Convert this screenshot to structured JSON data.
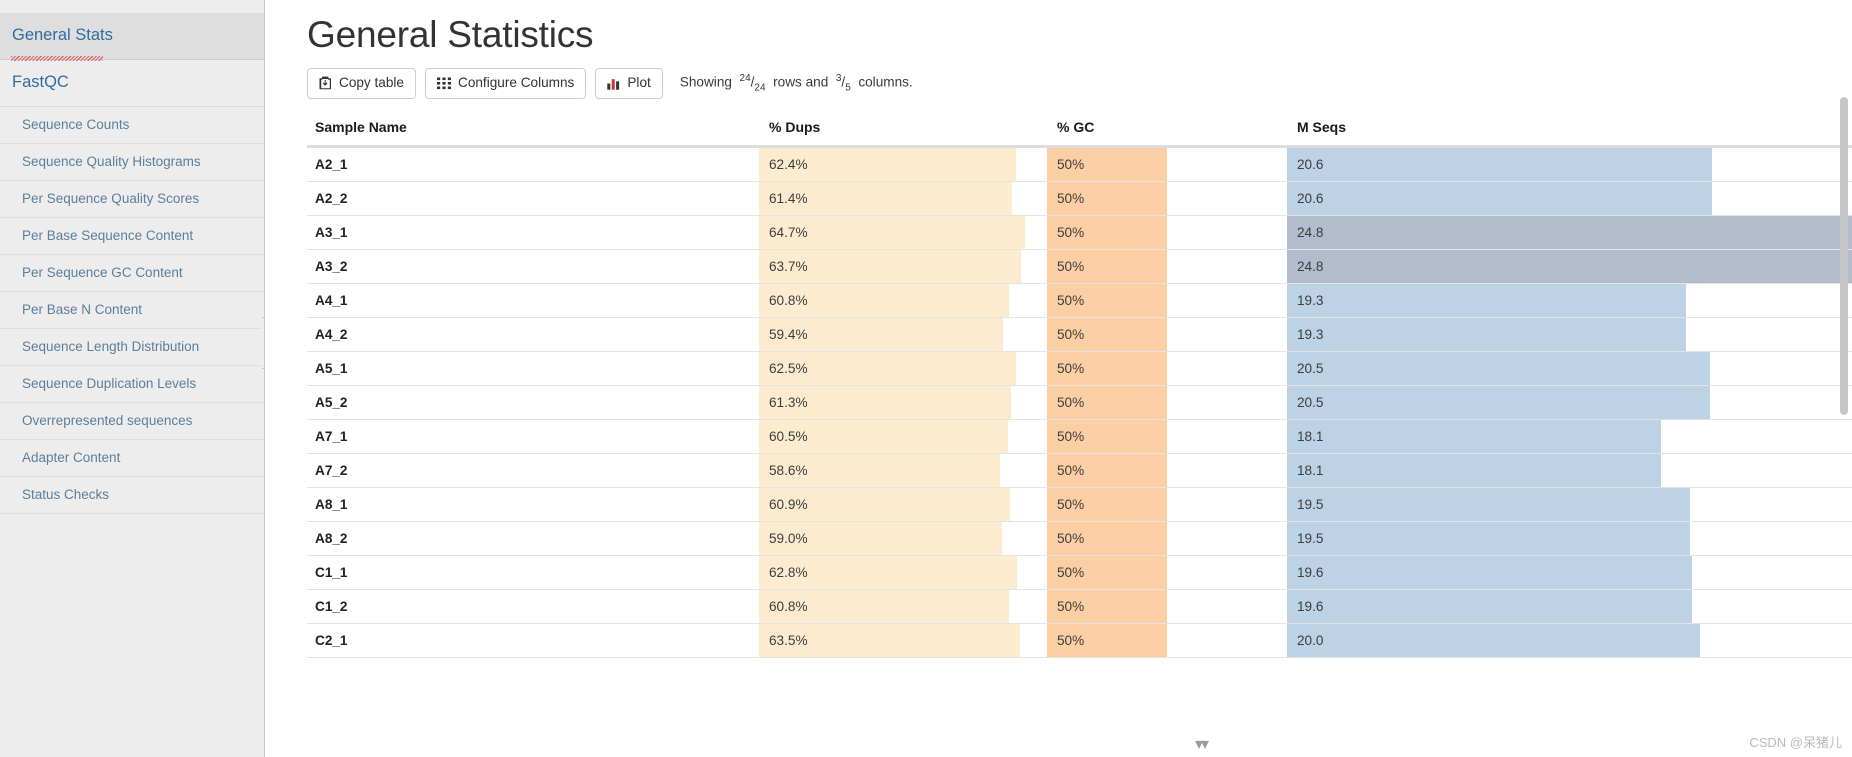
{
  "sidebar": {
    "general_stats_label": "General Stats",
    "module_label": "FastQC",
    "items": [
      {
        "label": "Sequence Counts"
      },
      {
        "label": "Sequence Quality Histograms"
      },
      {
        "label": "Per Sequence Quality Scores"
      },
      {
        "label": "Per Base Sequence Content"
      },
      {
        "label": "Per Sequence GC Content"
      },
      {
        "label": "Per Base N Content"
      },
      {
        "label": "Sequence Length Distribution"
      },
      {
        "label": "Sequence Duplication Levels"
      },
      {
        "label": "Overrepresented sequences"
      },
      {
        "label": "Adapter Content"
      },
      {
        "label": "Status Checks"
      }
    ]
  },
  "main": {
    "title": "General Statistics",
    "toolbar": {
      "copy_table_label": "Copy table",
      "configure_columns_label": "Configure Columns",
      "plot_label": "Plot",
      "showing_prefix": "Showing",
      "rows_shown": "24",
      "rows_total": "24",
      "rows_word": "rows and",
      "cols_shown": "3",
      "cols_total": "5",
      "cols_word": "columns."
    },
    "columns": [
      {
        "key": "sample",
        "label": "Sample Name"
      },
      {
        "key": "dups",
        "label": "% Dups"
      },
      {
        "key": "gc",
        "label": "% GC"
      },
      {
        "key": "seqs",
        "label": "M Seqs"
      }
    ],
    "colors": {
      "dups_bar": "#fdebd0",
      "gc_bar": "#fbcfa3",
      "seqs_bar": "#bdd2e5",
      "seqs_bar_highlight": "#b3bccd",
      "row_highlight": "#b3bccd",
      "link": "#2f6ca3",
      "sidebar_bg": "#ededed"
    },
    "rows": [
      {
        "sample": "A2_1",
        "dups": "62.4%",
        "dups_pct": 62.4,
        "gc": "50%",
        "gc_pct": 50,
        "seqs": "20.6",
        "seqs_pct": 20.6,
        "highlight": false
      },
      {
        "sample": "A2_2",
        "dups": "61.4%",
        "dups_pct": 61.4,
        "gc": "50%",
        "gc_pct": 50,
        "seqs": "20.6",
        "seqs_pct": 20.6,
        "highlight": false
      },
      {
        "sample": "A3_1",
        "dups": "64.7%",
        "dups_pct": 64.7,
        "gc": "50%",
        "gc_pct": 50,
        "seqs": "24.8",
        "seqs_pct": 24.8,
        "highlight": true
      },
      {
        "sample": "A3_2",
        "dups": "63.7%",
        "dups_pct": 63.7,
        "gc": "50%",
        "gc_pct": 50,
        "seqs": "24.8",
        "seqs_pct": 24.8,
        "highlight": true
      },
      {
        "sample": "A4_1",
        "dups": "60.8%",
        "dups_pct": 60.8,
        "gc": "50%",
        "gc_pct": 50,
        "seqs": "19.3",
        "seqs_pct": 19.3,
        "highlight": false
      },
      {
        "sample": "A4_2",
        "dups": "59.4%",
        "dups_pct": 59.4,
        "gc": "50%",
        "gc_pct": 50,
        "seqs": "19.3",
        "seqs_pct": 19.3,
        "highlight": false
      },
      {
        "sample": "A5_1",
        "dups": "62.5%",
        "dups_pct": 62.5,
        "gc": "50%",
        "gc_pct": 50,
        "seqs": "20.5",
        "seqs_pct": 20.5,
        "highlight": false
      },
      {
        "sample": "A5_2",
        "dups": "61.3%",
        "dups_pct": 61.3,
        "gc": "50%",
        "gc_pct": 50,
        "seqs": "20.5",
        "seqs_pct": 20.5,
        "highlight": false
      },
      {
        "sample": "A7_1",
        "dups": "60.5%",
        "dups_pct": 60.5,
        "gc": "50%",
        "gc_pct": 50,
        "seqs": "18.1",
        "seqs_pct": 18.1,
        "highlight": false
      },
      {
        "sample": "A7_2",
        "dups": "58.6%",
        "dups_pct": 58.6,
        "gc": "50%",
        "gc_pct": 50,
        "seqs": "18.1",
        "seqs_pct": 18.1,
        "highlight": false
      },
      {
        "sample": "A8_1",
        "dups": "60.9%",
        "dups_pct": 60.9,
        "gc": "50%",
        "gc_pct": 50,
        "seqs": "19.5",
        "seqs_pct": 19.5,
        "highlight": false
      },
      {
        "sample": "A8_2",
        "dups": "59.0%",
        "dups_pct": 59.0,
        "gc": "50%",
        "gc_pct": 50,
        "seqs": "19.5",
        "seqs_pct": 19.5,
        "highlight": false
      },
      {
        "sample": "C1_1",
        "dups": "62.8%",
        "dups_pct": 62.8,
        "gc": "50%",
        "gc_pct": 50,
        "seqs": "19.6",
        "seqs_pct": 19.6,
        "highlight": false
      },
      {
        "sample": "C1_2",
        "dups": "60.8%",
        "dups_pct": 60.8,
        "gc": "50%",
        "gc_pct": 50,
        "seqs": "19.6",
        "seqs_pct": 19.6,
        "highlight": false
      },
      {
        "sample": "C2_1",
        "dups": "63.5%",
        "dups_pct": 63.5,
        "gc": "50%",
        "gc_pct": 50,
        "seqs": "20.0",
        "seqs_pct": 20.0,
        "highlight": false
      }
    ]
  },
  "watermark": "CSDN @呆猪儿"
}
